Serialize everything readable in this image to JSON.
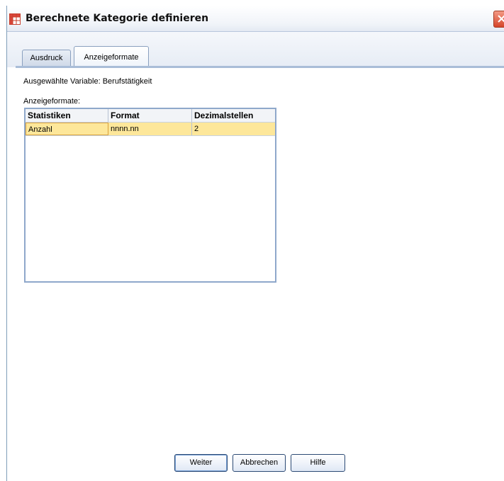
{
  "window": {
    "title": "Berechnete Kategorie definieren",
    "icon": "table-grid-icon",
    "close_icon": "close-icon"
  },
  "tabs": [
    {
      "label": "Ausdruck",
      "active": false
    },
    {
      "label": "Anzeigeformate",
      "active": true
    }
  ],
  "selected_variable_label": "Ausgewählte Variable: Berufstätigkeit",
  "formats_label": "Anzeigeformate:",
  "table": {
    "headers": [
      "Statistiken",
      "Format",
      "Dezimalstellen"
    ],
    "rows": [
      {
        "statistic": "Anzahl",
        "format": "nnnn.nn",
        "decimals": "2",
        "selected": true
      }
    ]
  },
  "buttons": {
    "continue": "Weiter",
    "cancel": "Abbrechen",
    "help": "Hilfe"
  },
  "colors": {
    "selected_row": "#fde79a",
    "accent_border": "#8fa8cb",
    "close_button": "#d5442a"
  }
}
